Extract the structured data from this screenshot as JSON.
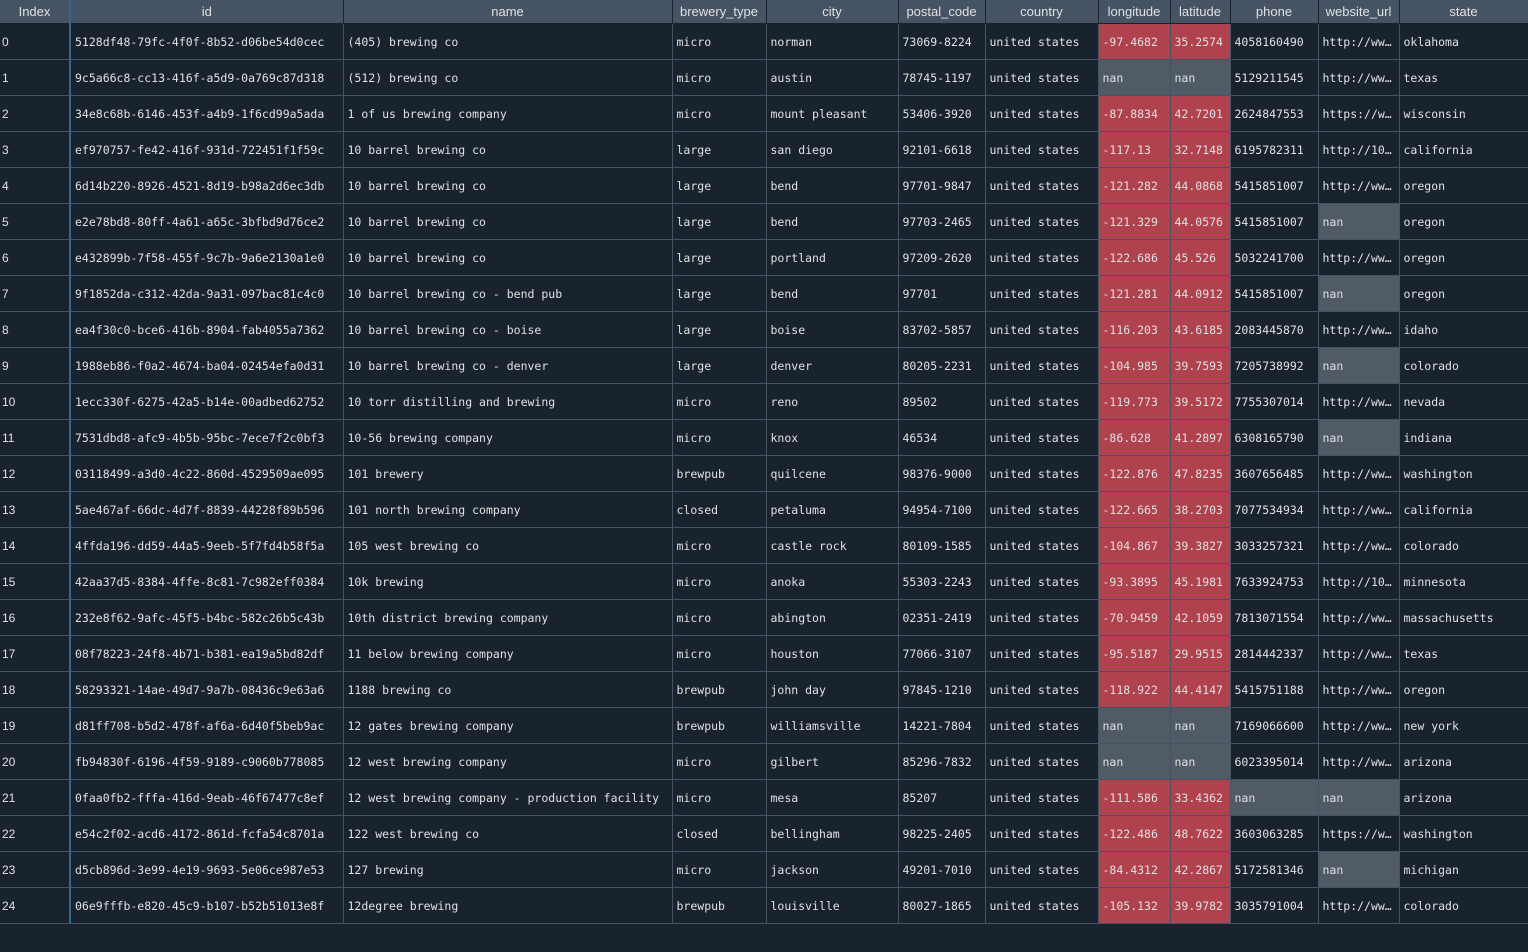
{
  "columns": [
    "Index",
    "id",
    "name",
    "brewery_type",
    "city",
    "postal_code",
    "country",
    "longitude",
    "latitude",
    "phone",
    "website_url",
    "state"
  ],
  "rows": [
    [
      "0",
      "5128df48-79fc-4f0f-8b52-d06be54d0cec",
      "(405) brewing co",
      "micro",
      "norman",
      "73069-8224",
      "united states",
      "-97.4682",
      "35.2574",
      "4058160490",
      "http://ww…",
      "oklahoma"
    ],
    [
      "1",
      "9c5a66c8-cc13-416f-a5d9-0a769c87d318",
      "(512) brewing co",
      "micro",
      "austin",
      "78745-1197",
      "united states",
      "nan",
      "nan",
      "5129211545",
      "http://ww…",
      "texas"
    ],
    [
      "2",
      "34e8c68b-6146-453f-a4b9-1f6cd99a5ada",
      "1 of us brewing company",
      "micro",
      "mount pleasant",
      "53406-3920",
      "united states",
      "-87.8834",
      "42.7201",
      "2624847553",
      "https://w…",
      "wisconsin"
    ],
    [
      "3",
      "ef970757-fe42-416f-931d-722451f1f59c",
      "10 barrel brewing co",
      "large",
      "san diego",
      "92101-6618",
      "united states",
      "-117.13",
      "32.7148",
      "6195782311",
      "http://10…",
      "california"
    ],
    [
      "4",
      "6d14b220-8926-4521-8d19-b98a2d6ec3db",
      "10 barrel brewing co",
      "large",
      "bend",
      "97701-9847",
      "united states",
      "-121.282",
      "44.0868",
      "5415851007",
      "http://ww…",
      "oregon"
    ],
    [
      "5",
      "e2e78bd8-80ff-4a61-a65c-3bfbd9d76ce2",
      "10 barrel brewing co",
      "large",
      "bend",
      "97703-2465",
      "united states",
      "-121.329",
      "44.0576",
      "5415851007",
      "nan",
      "oregon"
    ],
    [
      "6",
      "e432899b-7f58-455f-9c7b-9a6e2130a1e0",
      "10 barrel brewing co",
      "large",
      "portland",
      "97209-2620",
      "united states",
      "-122.686",
      "45.526",
      "5032241700",
      "http://ww…",
      "oregon"
    ],
    [
      "7",
      "9f1852da-c312-42da-9a31-097bac81c4c0",
      "10 barrel brewing co - bend pub",
      "large",
      "bend",
      "97701",
      "united states",
      "-121.281",
      "44.0912",
      "5415851007",
      "nan",
      "oregon"
    ],
    [
      "8",
      "ea4f30c0-bce6-416b-8904-fab4055a7362",
      "10 barrel brewing co - boise",
      "large",
      "boise",
      "83702-5857",
      "united states",
      "-116.203",
      "43.6185",
      "2083445870",
      "http://ww…",
      "idaho"
    ],
    [
      "9",
      "1988eb86-f0a2-4674-ba04-02454efa0d31",
      "10 barrel brewing co - denver",
      "large",
      "denver",
      "80205-2231",
      "united states",
      "-104.985",
      "39.7593",
      "7205738992",
      "nan",
      "colorado"
    ],
    [
      "10",
      "1ecc330f-6275-42a5-b14e-00adbed62752",
      "10 torr distilling and brewing",
      "micro",
      "reno",
      "89502",
      "united states",
      "-119.773",
      "39.5172",
      "7755307014",
      "http://ww…",
      "nevada"
    ],
    [
      "11",
      "7531dbd8-afc9-4b5b-95bc-7ece7f2c0bf3",
      "10-56 brewing company",
      "micro",
      "knox",
      "46534",
      "united states",
      "-86.628",
      "41.2897",
      "6308165790",
      "nan",
      "indiana"
    ],
    [
      "12",
      "03118499-a3d0-4c22-860d-4529509ae095",
      "101 brewery",
      "brewpub",
      "quilcene",
      "98376-9000",
      "united states",
      "-122.876",
      "47.8235",
      "3607656485",
      "http://ww…",
      "washington"
    ],
    [
      "13",
      "5ae467af-66dc-4d7f-8839-44228f89b596",
      "101 north brewing company",
      "closed",
      "petaluma",
      "94954-7100",
      "united states",
      "-122.665",
      "38.2703",
      "7077534934",
      "http://ww…",
      "california"
    ],
    [
      "14",
      "4ffda196-dd59-44a5-9eeb-5f7fd4b58f5a",
      "105 west brewing co",
      "micro",
      "castle rock",
      "80109-1585",
      "united states",
      "-104.867",
      "39.3827",
      "3033257321",
      "http://ww…",
      "colorado"
    ],
    [
      "15",
      "42aa37d5-8384-4ffe-8c81-7c982eff0384",
      "10k brewing",
      "micro",
      "anoka",
      "55303-2243",
      "united states",
      "-93.3895",
      "45.1981",
      "7633924753",
      "http://10…",
      "minnesota"
    ],
    [
      "16",
      "232e8f62-9afc-45f5-b4bc-582c26b5c43b",
      "10th district brewing company",
      "micro",
      "abington",
      "02351-2419",
      "united states",
      "-70.9459",
      "42.1059",
      "7813071554",
      "http://ww…",
      "massachusetts"
    ],
    [
      "17",
      "08f78223-24f8-4b71-b381-ea19a5bd82df",
      "11 below brewing company",
      "micro",
      "houston",
      "77066-3107",
      "united states",
      "-95.5187",
      "29.9515",
      "2814442337",
      "http://ww…",
      "texas"
    ],
    [
      "18",
      "58293321-14ae-49d7-9a7b-08436c9e63a6",
      "1188 brewing co",
      "brewpub",
      "john day",
      "97845-1210",
      "united states",
      "-118.922",
      "44.4147",
      "5415751188",
      "http://ww…",
      "oregon"
    ],
    [
      "19",
      "d81ff708-b5d2-478f-af6a-6d40f5beb9ac",
      "12 gates brewing company",
      "brewpub",
      "williamsville",
      "14221-7804",
      "united states",
      "nan",
      "nan",
      "7169066600",
      "http://ww…",
      "new york"
    ],
    [
      "20",
      "fb94830f-6196-4f59-9189-c9060b778085",
      "12 west brewing company",
      "micro",
      "gilbert",
      "85296-7832",
      "united states",
      "nan",
      "nan",
      "6023395014",
      "http://ww…",
      "arizona"
    ],
    [
      "21",
      "0faa0fb2-fffa-416d-9eab-46f67477c8ef",
      "12 west brewing company - production facility",
      "micro",
      "mesa",
      "85207",
      "united states",
      "-111.586",
      "33.4362",
      "nan",
      "nan",
      "arizona"
    ],
    [
      "22",
      "e54c2f02-acd6-4172-861d-fcfa54c8701a",
      "122 west brewing co",
      "closed",
      "bellingham",
      "98225-2405",
      "united states",
      "-122.486",
      "48.7622",
      "3603063285",
      "https://w…",
      "washington"
    ],
    [
      "23",
      "d5cb896d-3e99-4e19-9693-5e06ce987e53",
      "127 brewing",
      "micro",
      "jackson",
      "49201-7010",
      "united states",
      "-84.4312",
      "42.2867",
      "5172581346",
      "nan",
      "michigan"
    ],
    [
      "24",
      "06e9fffb-e820-45c9-b107-b52b51013e8f",
      "12degree brewing",
      "brewpub",
      "louisville",
      "80027-1865",
      "united states",
      "-105.132",
      "39.9782",
      "3035791004",
      "http://ww…",
      "colorado"
    ]
  ],
  "colors": {
    "background": "#19232d",
    "header": "#455364",
    "numeric_cell": "#b0424d",
    "nan_cell": "#515b66",
    "index_border": "#346792"
  }
}
